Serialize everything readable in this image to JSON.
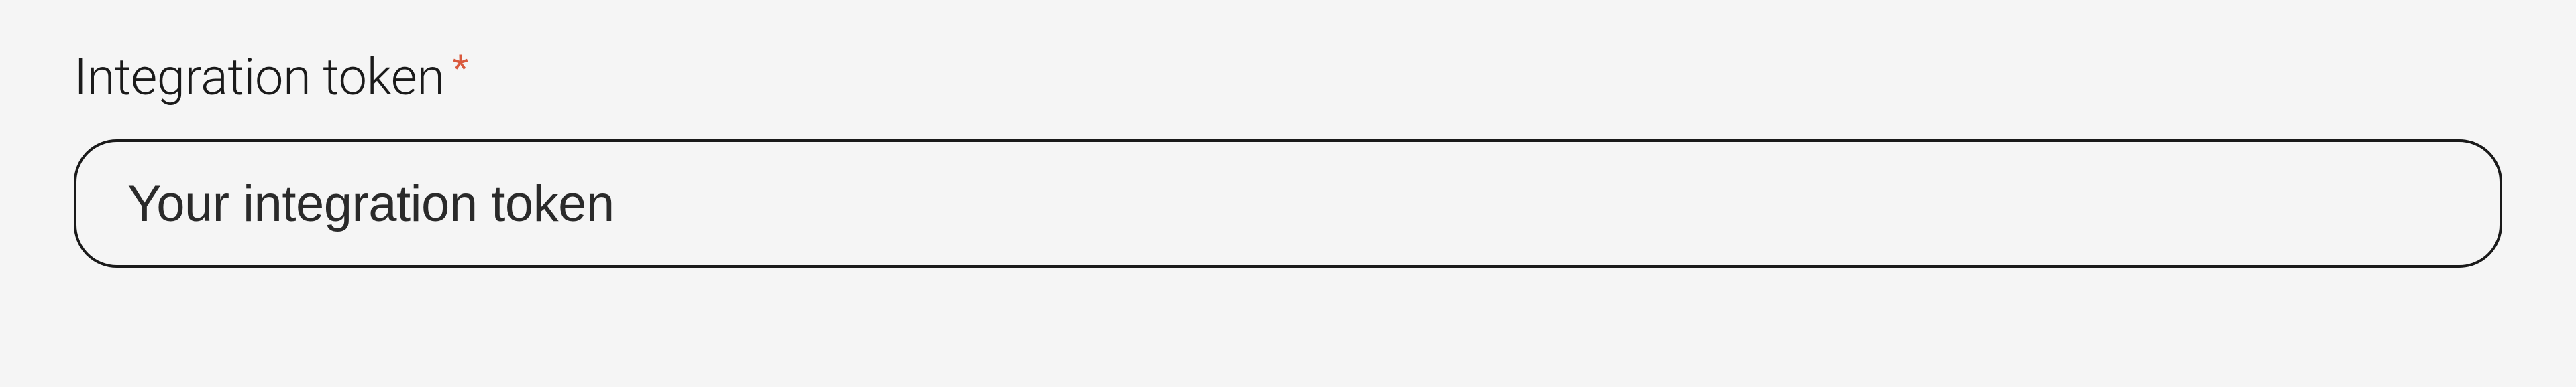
{
  "form": {
    "integration_token": {
      "label": "Integration token",
      "required_mark": "*",
      "placeholder": "Your integration token",
      "value": ""
    }
  }
}
